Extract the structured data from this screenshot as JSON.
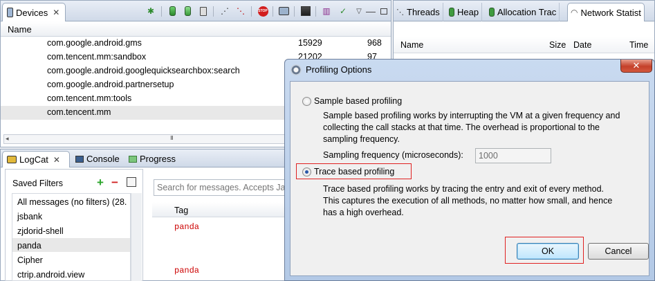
{
  "devices": {
    "tab_label": "Devices",
    "column_name": "Name",
    "rows": [
      {
        "name": "com.google.android.gms",
        "pid": "15929",
        "port": "968"
      },
      {
        "name": "com.tencent.mm:sandbox",
        "pid": "21202",
        "port": "97"
      },
      {
        "name": "com.google.android.googlequicksearchbox:search",
        "pid": "",
        "port": ""
      },
      {
        "name": "com.google.android.partnersetup",
        "pid": "",
        "port": ""
      },
      {
        "name": "com.tencent.mm:tools",
        "pid": "",
        "port": ""
      },
      {
        "name": "com.tencent.mm",
        "pid": "",
        "port": ""
      }
    ],
    "scroll_grip": "III"
  },
  "right_panel": {
    "tabs": [
      "Threads",
      "Heap",
      "Allocation Trac",
      "Network Statist"
    ],
    "columns": [
      "Name",
      "Size",
      "Date",
      "Time"
    ]
  },
  "logcat": {
    "tabs": [
      "LogCat",
      "Console",
      "Progress"
    ],
    "saved_filters_label": "Saved Filters",
    "filters": [
      "All messages (no filters) (28.",
      "jsbank",
      "zjdorid-shell",
      "panda",
      "Cipher",
      "ctrip.android.view"
    ],
    "search_placeholder": "Search for messages. Accepts Ja",
    "tag_header": "Tag",
    "tag_rows": [
      "panda",
      "panda"
    ]
  },
  "dialog": {
    "title": "Profiling Options",
    "sample_option": "Sample based profiling",
    "sample_desc": [
      "Sample based profiling works by interrupting the VM at a given frequency and",
      "collecting the call stacks at that time. The overhead is proportional to the",
      "sampling frequency."
    ],
    "freq_label": "Sampling frequency (microseconds):",
    "freq_value": "1000",
    "trace_option": "Trace based profiling",
    "trace_desc": [
      "Trace based profiling works by tracing the entry and exit of every method.",
      "This captures the execution of all methods, no matter how small, and hence",
      "has a high overhead."
    ],
    "ok_label": "OK",
    "cancel_label": "Cancel",
    "selected": "trace"
  },
  "colors": {
    "accent_red": "#e02020",
    "tag_red": "#cc0000",
    "selection": "#e8e8e8"
  }
}
